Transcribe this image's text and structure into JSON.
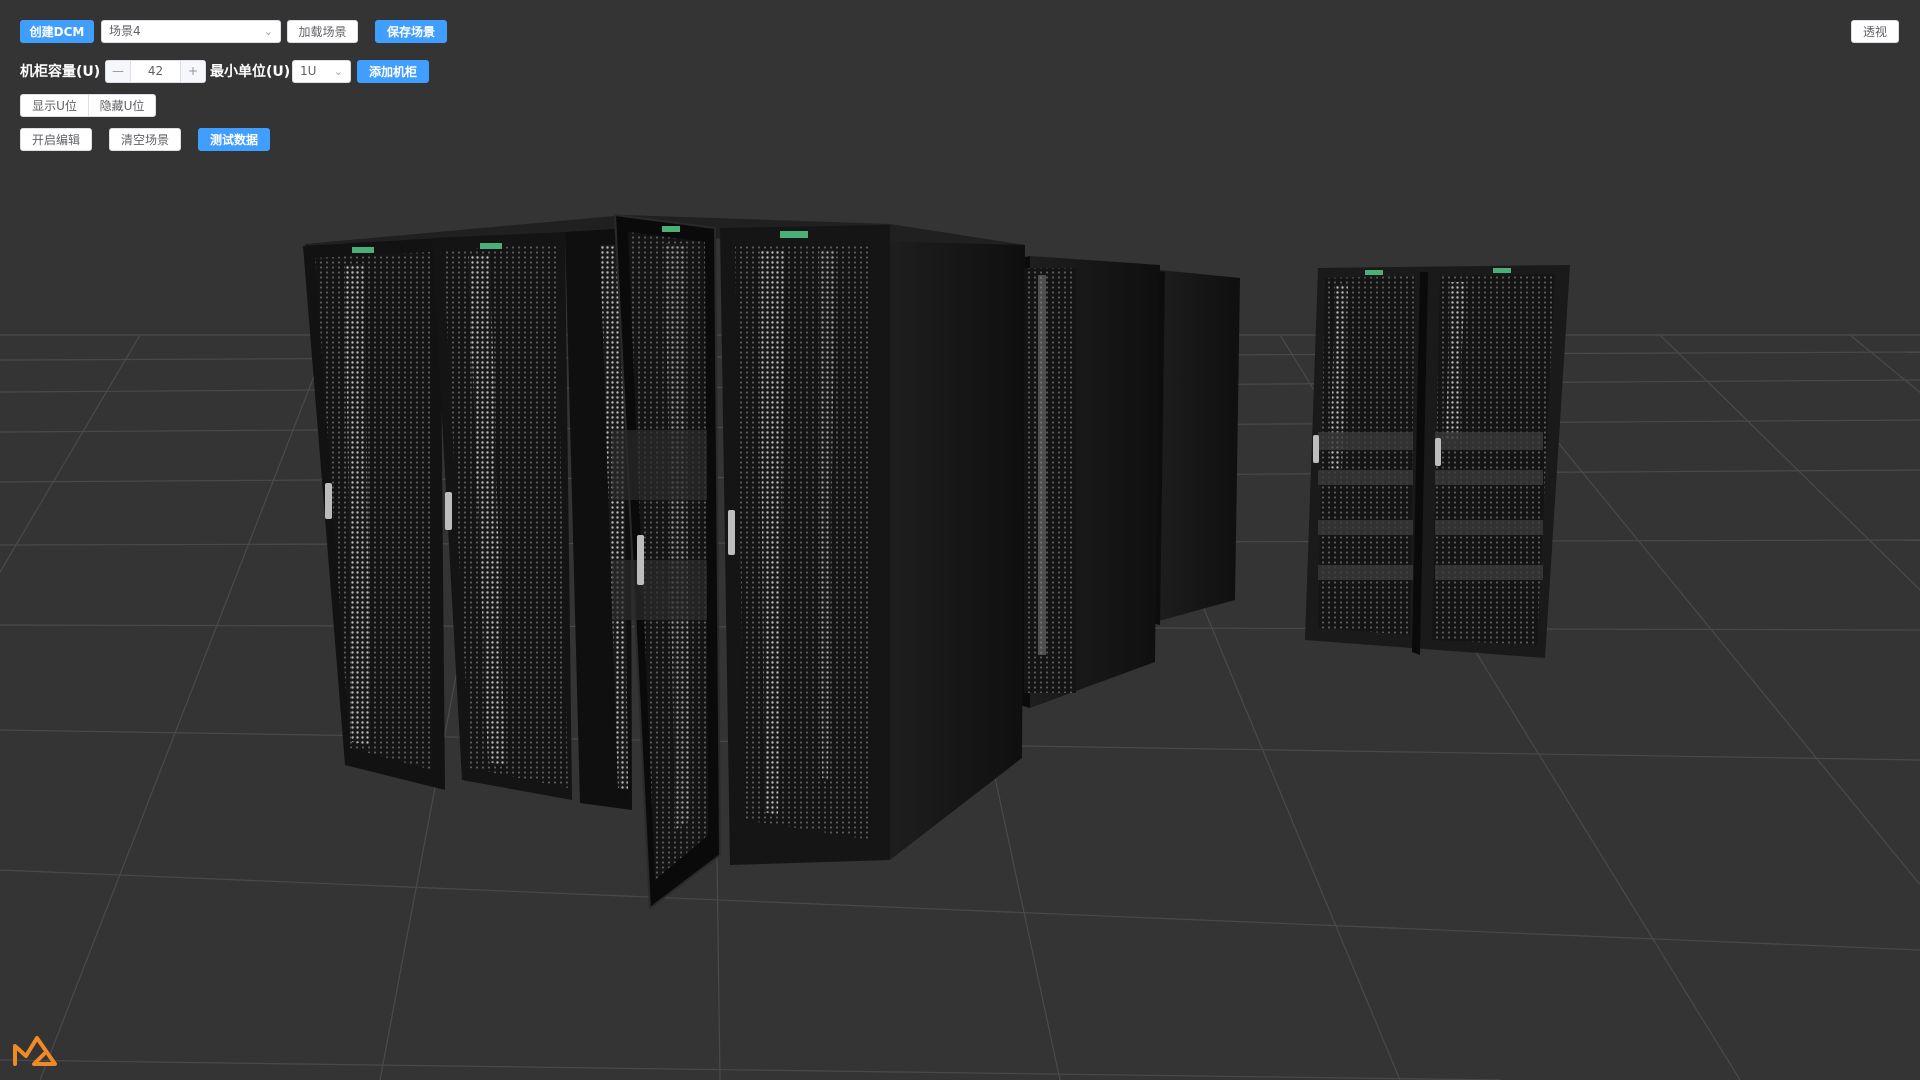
{
  "toolbar": {
    "create_dcm": "创建DCM",
    "scene_select_value": "场景4",
    "load_scene": "加载场景",
    "save_scene": "保存场景",
    "perspective": "透视"
  },
  "cabinet_row": {
    "capacity_label": "机柜容量(U)",
    "capacity_value": "42",
    "min_unit_label": "最小单位(U)",
    "min_unit_value": "1U",
    "add_cabinet": "添加机柜"
  },
  "u_toggle": {
    "show_u": "显示U位",
    "hide_u": "隐藏U位"
  },
  "actions": {
    "edit_mode": "开启编辑",
    "clear_scene": "清空场景",
    "test_data": "测试数据"
  },
  "icons": {
    "stepper_minus": "minus-icon",
    "stepper_plus": "plus-icon",
    "dropdown": "chevron-down-icon",
    "logo": "brand-logo-icon"
  },
  "colors": {
    "background": "#343434",
    "primary": "#409eff",
    "logo": "#f08a24",
    "rack_body": "#1b1b1b",
    "rack_label": "#4caf7a"
  }
}
